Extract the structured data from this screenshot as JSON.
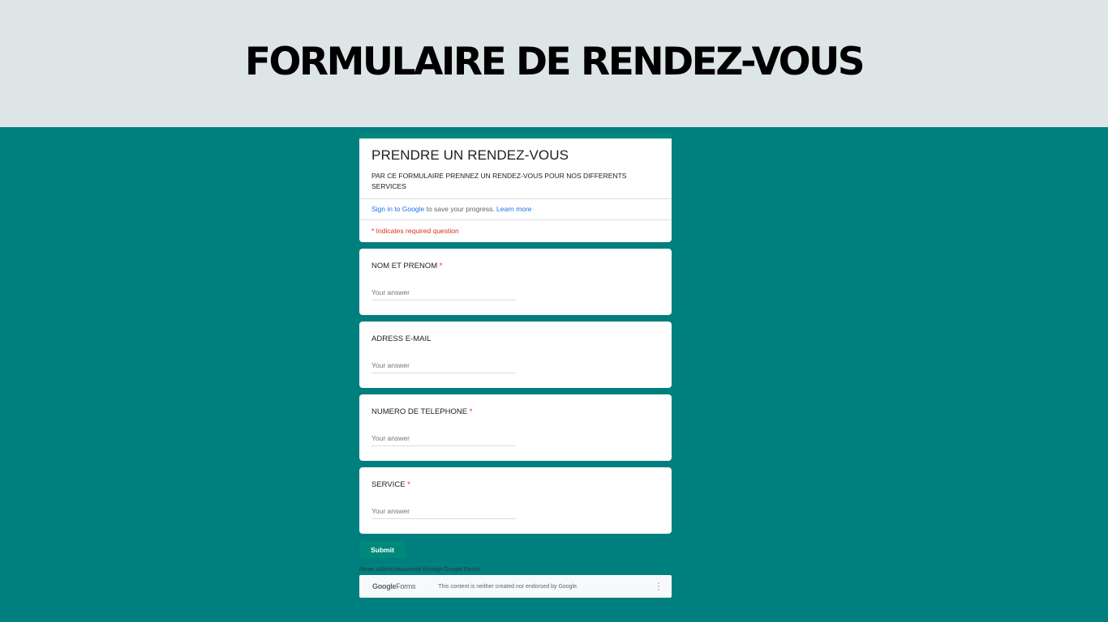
{
  "banner": {
    "title": "FORMULAIRE DE RENDEZ-VOUS"
  },
  "form": {
    "title": "PRENDRE UN RENDEZ-VOUS",
    "description": "PAR CE FORMULAIRE PRENNEZ UN RENDEZ-VOUS POUR NOS DIFFERENTS SERVICES",
    "signin_link": "Sign in to Google",
    "signin_rest": " to save your progress. ",
    "learn_more": "Learn more",
    "required_note": "* Indicates required question",
    "questions": [
      {
        "label": "NOM ET PRENOM",
        "required": "*",
        "placeholder": "Your answer"
      },
      {
        "label": "ADRESS E-MAIL",
        "required": "",
        "placeholder": "Your answer"
      },
      {
        "label": "NUMERO DE TELEPHONE",
        "required": "*",
        "placeholder": "Your answer"
      },
      {
        "label": "SERVICE",
        "required": "*",
        "placeholder": "Your answer"
      }
    ],
    "submit_label": "Submit",
    "warning": "Never submit passwords through Google Forms."
  },
  "footer": {
    "logo_google": "Google",
    "logo_forms": "Forms",
    "disclaimer": "This content is neither created nor endorsed by Google.",
    "menu_icon": "more-vert-icon"
  },
  "colors": {
    "background": "#007f7f",
    "banner": "#dde5e6",
    "accent": "#00897b",
    "required": "#d93025",
    "link": "#1a73e8"
  }
}
